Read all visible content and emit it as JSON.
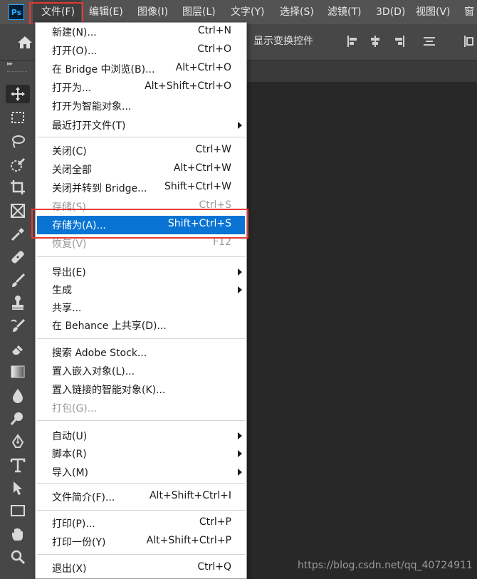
{
  "app": {
    "logo_text": "Ps"
  },
  "menubar": {
    "items": [
      {
        "label": "文件(F)"
      },
      {
        "label": "编辑(E)"
      },
      {
        "label": "图像(I)"
      },
      {
        "label": "图层(L)"
      },
      {
        "label": "文字(Y)"
      },
      {
        "label": "选择(S)"
      },
      {
        "label": "滤镜(T)"
      },
      {
        "label": "3D(D)"
      },
      {
        "label": "视图(V)"
      },
      {
        "label": "窗"
      }
    ]
  },
  "options_bar": {
    "label": "显示变换控件"
  },
  "file_menu": {
    "items": [
      {
        "label": "新建(N)...",
        "shortcut": "Ctrl+N"
      },
      {
        "label": "打开(O)...",
        "shortcut": "Ctrl+O"
      },
      {
        "label": "在 Bridge 中浏览(B)...",
        "shortcut": "Alt+Ctrl+O"
      },
      {
        "label": "打开为...",
        "shortcut": "Alt+Shift+Ctrl+O"
      },
      {
        "label": "打开为智能对象...",
        "shortcut": ""
      },
      {
        "label": "最近打开文件(T)",
        "shortcut": ""
      },
      {
        "label": "关闭(C)",
        "shortcut": "Ctrl+W"
      },
      {
        "label": "关闭全部",
        "shortcut": "Alt+Ctrl+W"
      },
      {
        "label": "关闭并转到 Bridge...",
        "shortcut": "Shift+Ctrl+W"
      },
      {
        "label": "存储(S)",
        "shortcut": "Ctrl+S"
      },
      {
        "label": "存储为(A)...",
        "shortcut": "Shift+Ctrl+S"
      },
      {
        "label": "恢复(V)",
        "shortcut": "F12"
      },
      {
        "label": "导出(E)",
        "shortcut": ""
      },
      {
        "label": "生成",
        "shortcut": ""
      },
      {
        "label": "共享...",
        "shortcut": ""
      },
      {
        "label": "在 Behance 上共享(D)...",
        "shortcut": ""
      },
      {
        "label": "搜索 Adobe Stock...",
        "shortcut": ""
      },
      {
        "label": "置入嵌入对象(L)...",
        "shortcut": ""
      },
      {
        "label": "置入链接的智能对象(K)...",
        "shortcut": ""
      },
      {
        "label": "打包(G)...",
        "shortcut": ""
      },
      {
        "label": "自动(U)",
        "shortcut": ""
      },
      {
        "label": "脚本(R)",
        "shortcut": ""
      },
      {
        "label": "导入(M)",
        "shortcut": ""
      },
      {
        "label": "文件简介(F)...",
        "shortcut": "Alt+Shift+Ctrl+I"
      },
      {
        "label": "打印(P)...",
        "shortcut": "Ctrl+P"
      },
      {
        "label": "打印一份(Y)",
        "shortcut": "Alt+Shift+Ctrl+P"
      },
      {
        "label": "退出(X)",
        "shortcut": "Ctrl+Q"
      }
    ]
  },
  "colors": {
    "highlight": "#0a74d4",
    "annotation_box": "#e53935",
    "menubar_bg": "#535353",
    "workspace_bg": "#282828"
  },
  "watermark": "https://blog.csdn.net/qq_40724911"
}
